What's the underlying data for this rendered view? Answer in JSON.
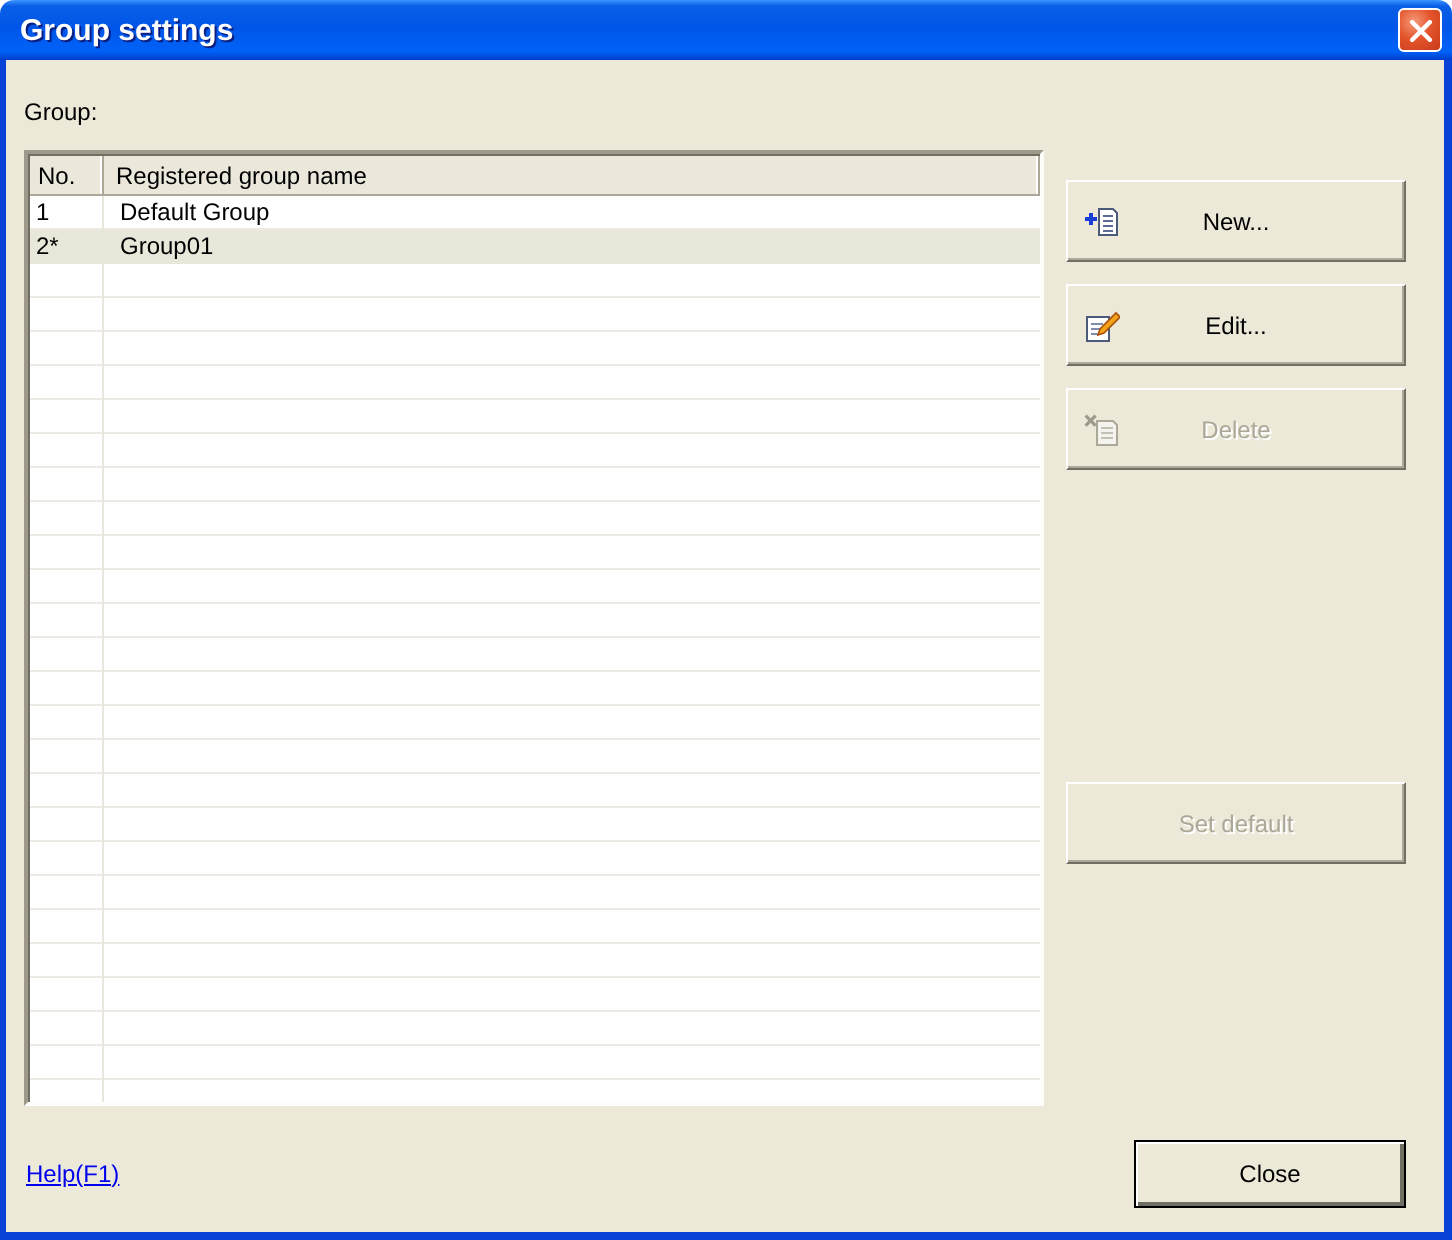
{
  "window": {
    "title": "Group settings"
  },
  "group_list": {
    "label": "Group:",
    "columns": [
      "No.",
      "Registered group name"
    ],
    "rows": [
      {
        "cells": [
          "1",
          "Default Group"
        ],
        "selected": false
      },
      {
        "cells": [
          "2*",
          "Group01"
        ],
        "selected": true
      }
    ]
  },
  "buttons": [
    {
      "kind": "new",
      "label": "New...",
      "disabled": false
    },
    {
      "kind": "edit",
      "label": "Edit...",
      "disabled": false
    },
    {
      "kind": "delete",
      "label": "Delete",
      "disabled": true
    },
    {
      "kind": "plain",
      "label": "Set default",
      "disabled": true
    }
  ],
  "footer": {
    "help_link": "Help(F1)",
    "close_button": {
      "label": "Close",
      "default": true
    }
  }
}
